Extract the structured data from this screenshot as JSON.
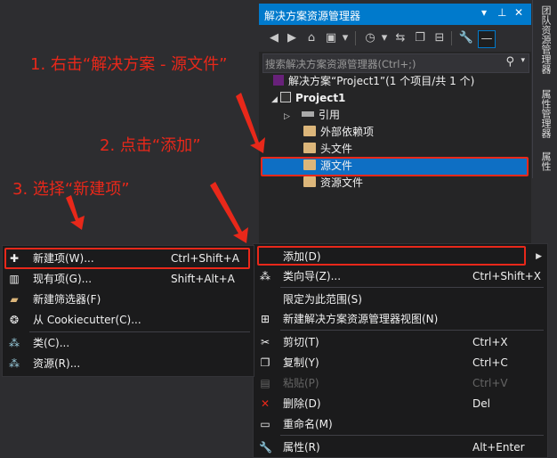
{
  "panel": {
    "title": "解决方案资源管理器",
    "search_placeholder": "搜索解决方案资源管理器(Ctrl+;)",
    "tree": {
      "solution": "解决方案“Project1”(1 个项目/共 1 个)",
      "project": "Project1",
      "references": "引用",
      "external": "外部依赖项",
      "headers": "头文件",
      "sources": "源文件",
      "resources": "资源文件"
    }
  },
  "side_tabs": [
    "团队资源管理器",
    "属性管理器",
    "属性"
  ],
  "annotations": {
    "step1": "1. 右击“解决方案 - 源文件”",
    "step2": "2. 点击“添加”",
    "step3": "3. 选择“新建项”"
  },
  "context_menu": {
    "items": [
      {
        "label": "添加(D)",
        "shortcut": ""
      },
      {
        "label": "类向导(Z)...",
        "shortcut": "Ctrl+Shift+X"
      },
      {
        "label": "限定为此范围(S)",
        "shortcut": ""
      },
      {
        "label": "新建解决方案资源管理器视图(N)",
        "shortcut": ""
      },
      {
        "label": "剪切(T)",
        "shortcut": "Ctrl+X"
      },
      {
        "label": "复制(Y)",
        "shortcut": "Ctrl+C"
      },
      {
        "label": "粘贴(P)",
        "shortcut": "Ctrl+V"
      },
      {
        "label": "删除(D)",
        "shortcut": "Del"
      },
      {
        "label": "重命名(M)",
        "shortcut": ""
      },
      {
        "label": "属性(R)",
        "shortcut": "Alt+Enter"
      }
    ]
  },
  "submenu": {
    "items": [
      {
        "label": "新建项(W)...",
        "shortcut": "Ctrl+Shift+A"
      },
      {
        "label": "现有项(G)...",
        "shortcut": "Shift+Alt+A"
      },
      {
        "label": "新建筛选器(F)",
        "shortcut": ""
      },
      {
        "label": "从 Cookiecutter(C)...",
        "shortcut": ""
      },
      {
        "label": "类(C)...",
        "shortcut": ""
      },
      {
        "label": "资源(R)...",
        "shortcut": ""
      }
    ]
  },
  "colors": {
    "accent": "#007acc",
    "annotation": "#e8281a",
    "selection": "#0e6fc4",
    "folder": "#dcb67a"
  }
}
